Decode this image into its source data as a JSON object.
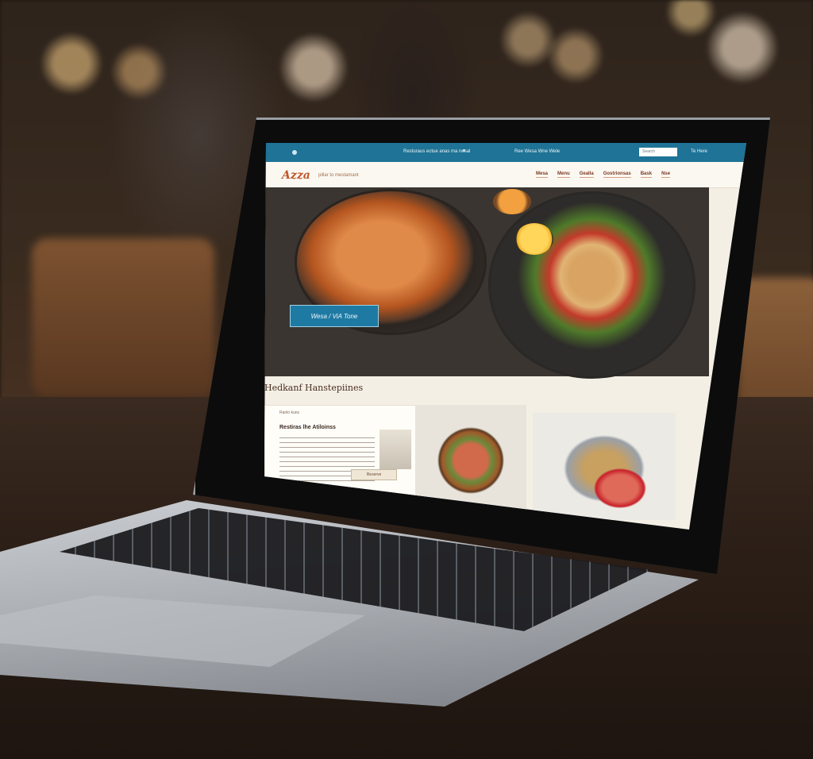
{
  "topbar": {
    "meta_text": "Resturaus ectue anas ma nesal",
    "links_text": "Ree Wesa Wne Wele",
    "search_placeholder": "Search",
    "lang": "Te Here"
  },
  "header": {
    "logo": "Azza",
    "tagline": "pillar to mestamant",
    "nav": [
      "Mesa",
      "Menu",
      "Gealla",
      "Gostrionsas",
      "Bask",
      "Nse"
    ]
  },
  "hero": {
    "badge_text": "Wesa / ViA Tone"
  },
  "section": {
    "title": "Hedkanf Hanstepiines"
  },
  "card_text": {
    "label": "Ranlo kuns",
    "heading": "Restiras lhe Atiloinss",
    "button": "Reserve"
  }
}
